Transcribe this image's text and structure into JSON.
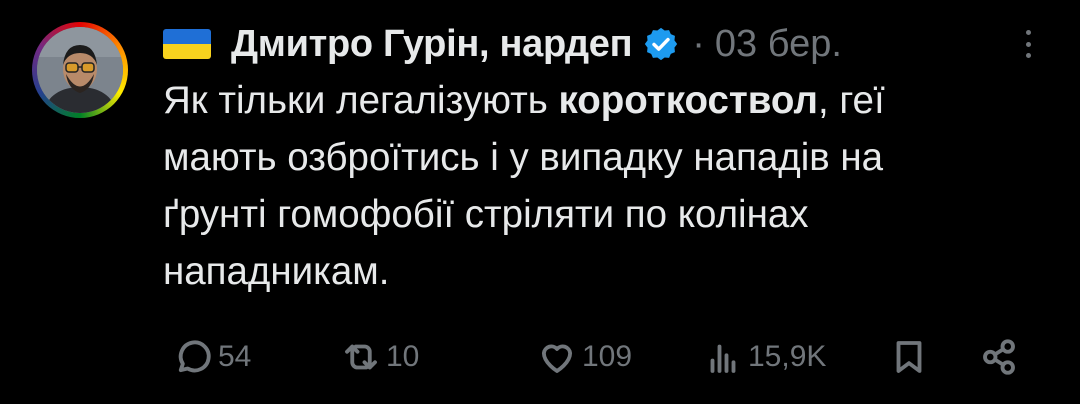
{
  "tweet": {
    "author_name": "Дмитро Гурін, нардеп",
    "separator": "·",
    "date": "03 бер.",
    "text_lines": [
      {
        "before": "Як тільки легалізують ",
        "bold": "короткоствол",
        "after": ", геї"
      },
      {
        "before": "мають озброїтись і у випадку нападів на",
        "bold": "",
        "after": ""
      },
      {
        "before": "ґрунті гомофобії стріляти по колінах",
        "bold": "",
        "after": ""
      },
      {
        "before": "нападникам.",
        "bold": "",
        "after": ""
      }
    ]
  },
  "actions": {
    "replies": "54",
    "reposts": "10",
    "likes": "109",
    "views": "15,9K"
  },
  "icons": {
    "flag": "ukraine-flag-icon",
    "verified": "verified-badge-icon",
    "more": "more-vertical-icon",
    "reply": "reply-icon",
    "repost": "repost-icon",
    "like": "heart-icon",
    "views": "views-chart-icon",
    "bookmark": "bookmark-icon",
    "share": "share-icon"
  },
  "colors": {
    "background": "#000000",
    "text": "#e7e9ea",
    "muted": "#71767b",
    "verified": "#1d9bf0",
    "flag_blue": "#1f6fd6",
    "flag_yellow": "#f7d21e"
  }
}
